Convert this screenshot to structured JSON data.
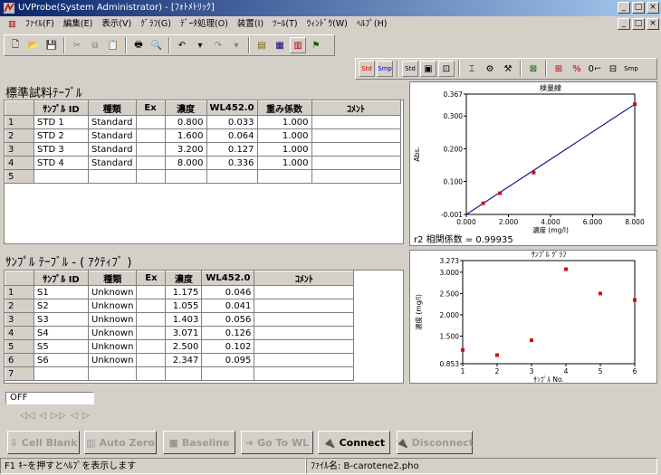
{
  "window": {
    "title": "UVProbe(System Administrator) - [ﾌｫﾄﾒﾄﾘｯｸ]"
  },
  "menu": [
    "ﾌｧｲﾙ(F)",
    "編集(E)",
    "表示(V)",
    "ｸﾞﾗﾌ(G)",
    "ﾃﾞｰﾀ処理(O)",
    "装置(I)",
    "ﾂｰﾙ(T)",
    "ｳｨﾝﾄﾞｳ(W)",
    "ﾍﾙﾌﾟ(H)"
  ],
  "standard": {
    "title": "標準試料ﾃｰﾌﾞﾙ",
    "columns": [
      "ｻﾝﾌﾟﾙ ID",
      "種類",
      "Ex",
      "濃度",
      "WL452.0",
      "重み係数",
      "ｺﾒﾝﾄ"
    ],
    "rows": [
      {
        "n": "1",
        "id": "STD 1",
        "type": "Standard",
        "ex": "",
        "conc": "0.800",
        "wl": "0.033",
        "w": "1.000",
        "c": ""
      },
      {
        "n": "2",
        "id": "STD 2",
        "type": "Standard",
        "ex": "",
        "conc": "1.600",
        "wl": "0.064",
        "w": "1.000",
        "c": ""
      },
      {
        "n": "3",
        "id": "STD 3",
        "type": "Standard",
        "ex": "",
        "conc": "3.200",
        "wl": "0.127",
        "w": "1.000",
        "c": ""
      },
      {
        "n": "4",
        "id": "STD 4",
        "type": "Standard",
        "ex": "",
        "conc": "8.000",
        "wl": "0.336",
        "w": "1.000",
        "c": ""
      },
      {
        "n": "5",
        "id": "",
        "type": "",
        "ex": "",
        "conc": "",
        "wl": "",
        "w": "",
        "c": ""
      }
    ]
  },
  "sample": {
    "title": "ｻﾝﾌﾟﾙ ﾃｰﾌﾞﾙ - ( ｱｸﾃｨﾌﾞ )",
    "columns": [
      "ｻﾝﾌﾟﾙ ID",
      "種類",
      "Ex",
      "濃度",
      "WL452.0",
      "ｺﾒﾝﾄ"
    ],
    "rows": [
      {
        "n": "1",
        "id": "S1",
        "type": "Unknown",
        "ex": "",
        "conc": "1.175",
        "wl": "0.046",
        "c": ""
      },
      {
        "n": "2",
        "id": "S2",
        "type": "Unknown",
        "ex": "",
        "conc": "1.055",
        "wl": "0.041",
        "c": ""
      },
      {
        "n": "3",
        "id": "S3",
        "type": "Unknown",
        "ex": "",
        "conc": "1.403",
        "wl": "0.056",
        "c": ""
      },
      {
        "n": "4",
        "id": "S4",
        "type": "Unknown",
        "ex": "",
        "conc": "3.071",
        "wl": "0.126",
        "c": ""
      },
      {
        "n": "5",
        "id": "S5",
        "type": "Unknown",
        "ex": "",
        "conc": "2.500",
        "wl": "0.102",
        "c": ""
      },
      {
        "n": "6",
        "id": "S6",
        "type": "Unknown",
        "ex": "",
        "conc": "2.347",
        "wl": "0.095",
        "c": ""
      },
      {
        "n": "7",
        "id": "",
        "type": "",
        "ex": "",
        "conc": "",
        "wl": "",
        "c": ""
      }
    ]
  },
  "chart_data": [
    {
      "type": "scatter",
      "title": "検量線",
      "xlabel": "濃度 (mg/l)",
      "ylabel": "Abs.",
      "xlim": [
        0,
        8
      ],
      "ylim": [
        -0.001,
        0.367
      ],
      "xticks": [
        "0.000",
        "2.000",
        "4.000",
        "6.000",
        "8.000"
      ],
      "yticks": [
        "-0.001",
        "0.100",
        "0.200",
        "0.300",
        "0.367"
      ],
      "points": [
        [
          0.8,
          0.033
        ],
        [
          1.6,
          0.064
        ],
        [
          3.2,
          0.127
        ],
        [
          8.0,
          0.336
        ]
      ],
      "fit_line": [
        [
          0.0,
          -0.001
        ],
        [
          8.0,
          0.336
        ]
      ],
      "footer": "r2 相関係数 = 0.99935"
    },
    {
      "type": "scatter",
      "title": "ｻﾝﾌﾟﾙ ｸﾞﾗﾌ",
      "xlabel": "ｻﾝﾌﾟﾙ No.",
      "ylabel": "濃度 (mg/l)",
      "xlim": [
        1,
        6
      ],
      "ylim": [
        0.853,
        3.273
      ],
      "xticks": [
        "1",
        "2",
        "3",
        "4",
        "5",
        "6"
      ],
      "yticks": [
        "0.853",
        "1.500",
        "2.000",
        "2.500",
        "3.000",
        "3.273"
      ],
      "points": [
        [
          1,
          1.175
        ],
        [
          2,
          1.055
        ],
        [
          3,
          1.403
        ],
        [
          4,
          3.071
        ],
        [
          5,
          2.5
        ],
        [
          6,
          2.347
        ]
      ]
    }
  ],
  "status_field": "OFF",
  "nav": "◁◁ ◁ ▷▷      ◁  ▷",
  "buttons": {
    "cell_blank": "Cell Blank",
    "auto_zero": "Auto Zero",
    "baseline": "Baseline",
    "go_to_wl": "Go To WL",
    "connect": "Connect",
    "disconnect": "Disconnect"
  },
  "statusbar": {
    "help": "F1 ｷｰを押すとﾍﾙﾌﾟを表示します",
    "file": "ﾌｧｲﾙ名: B-carotene2.pho"
  }
}
